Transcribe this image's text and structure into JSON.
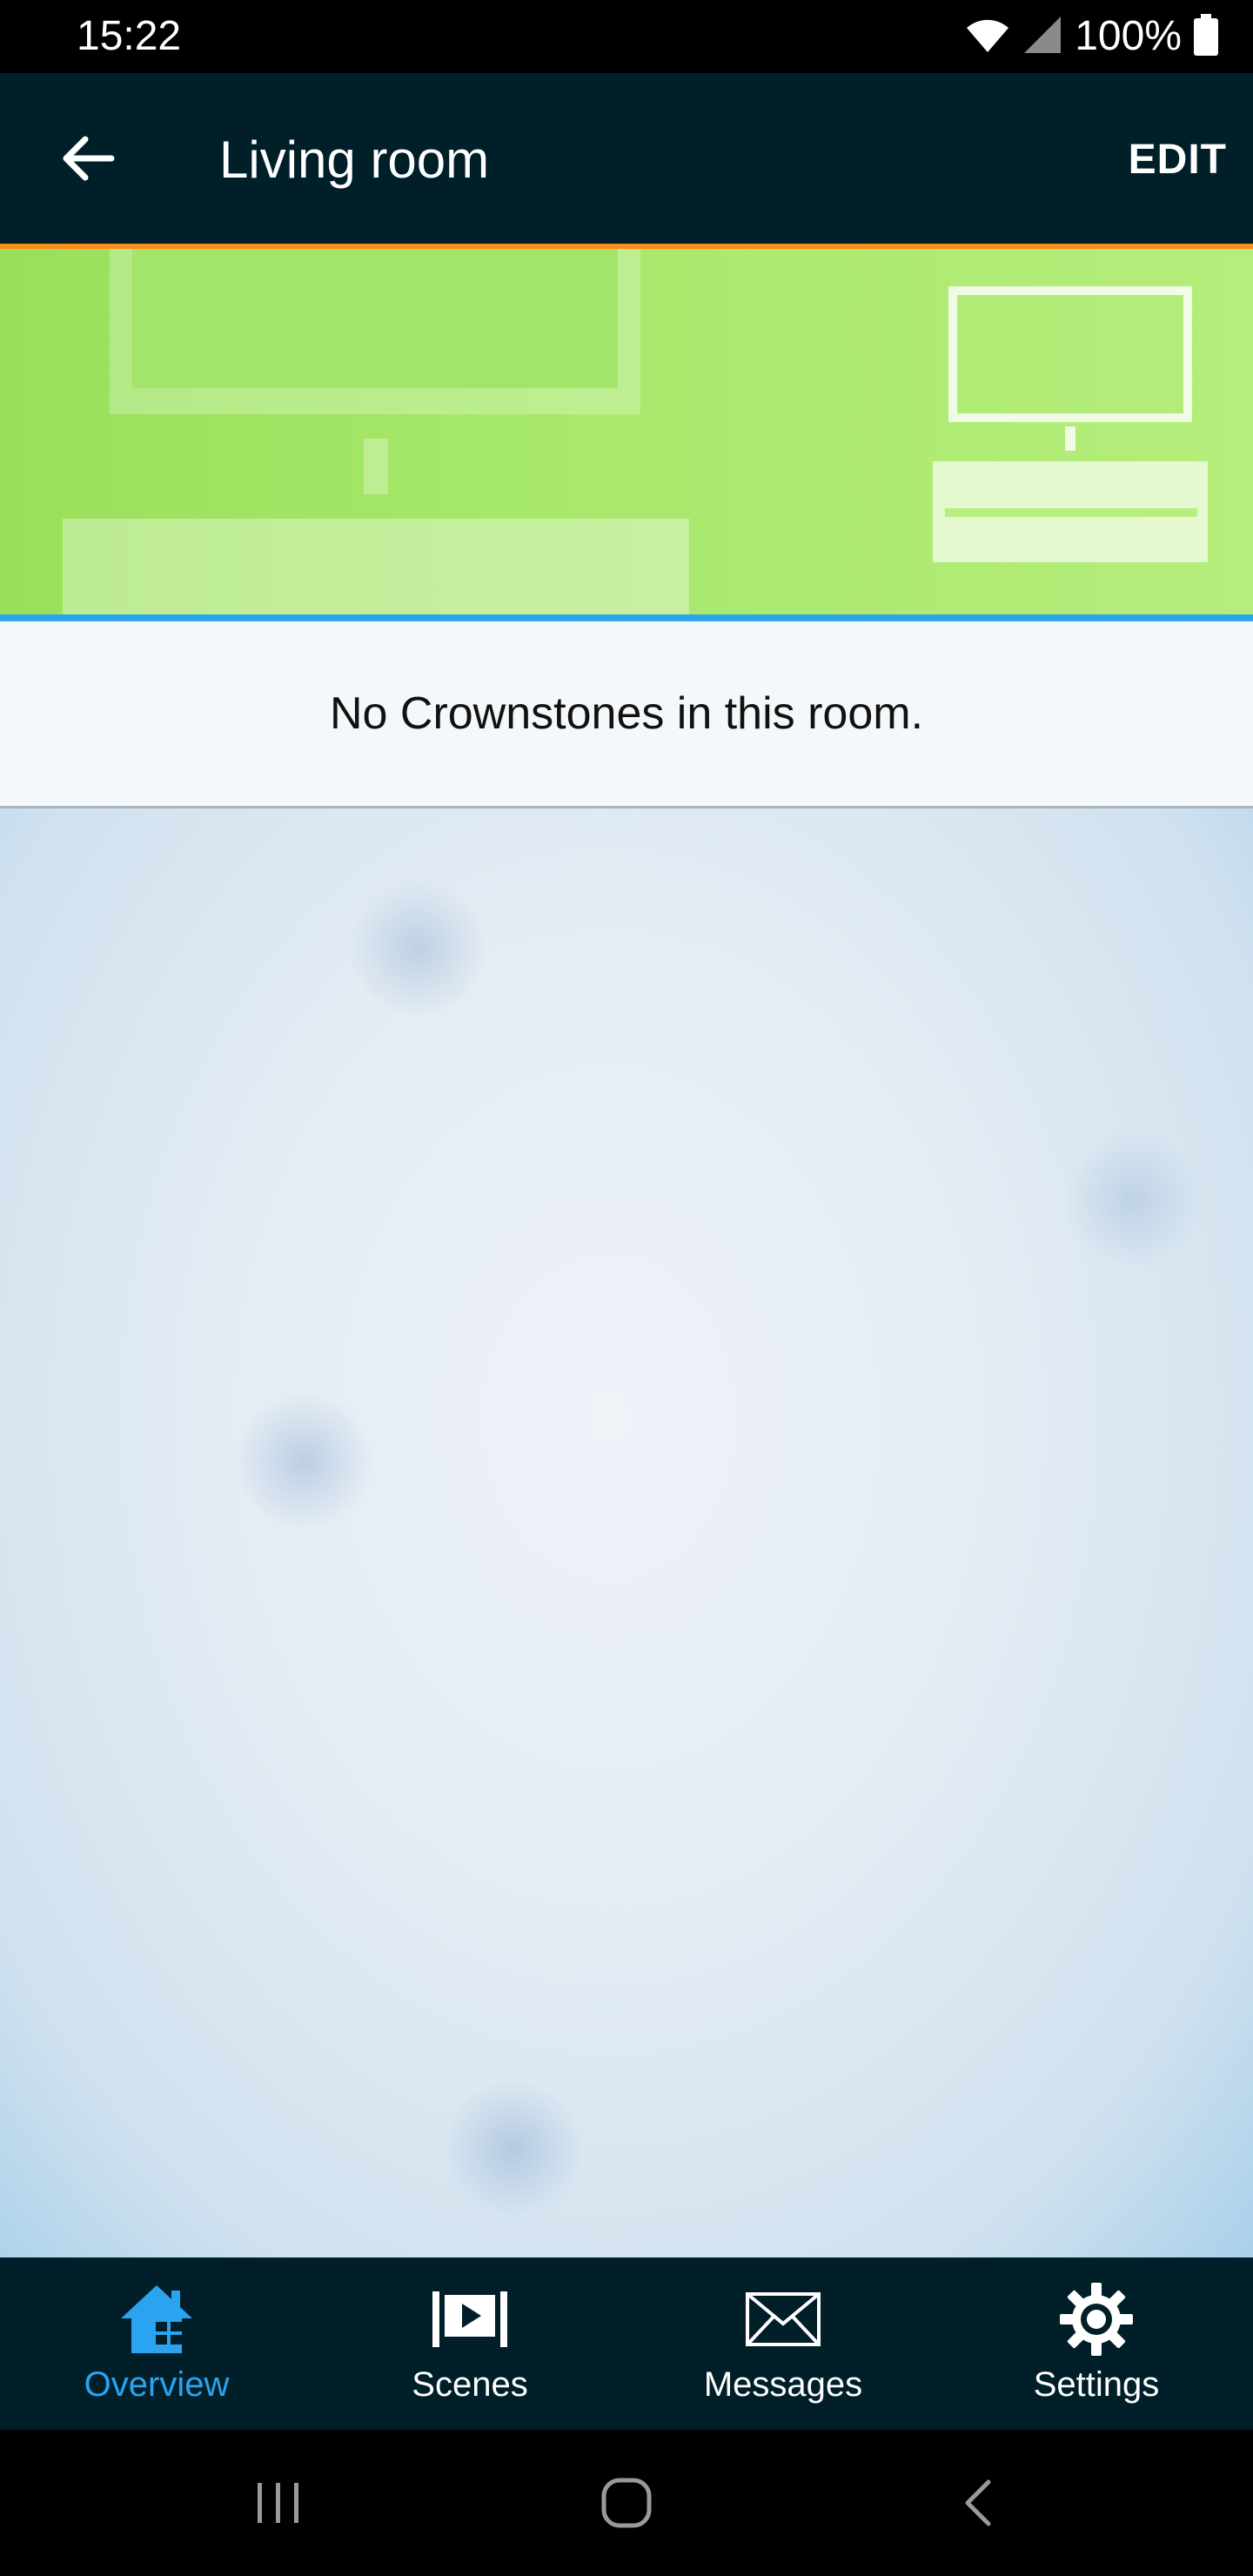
{
  "status_bar": {
    "time": "15:22",
    "battery": "100%"
  },
  "header": {
    "title": "Living room",
    "edit_label": "EDIT",
    "background": "#001f29",
    "accent": "#ff8c1a"
  },
  "room": {
    "empty_message": "No Crownstones in this room."
  },
  "nav": {
    "items": [
      {
        "label": "Overview",
        "icon": "home-icon",
        "active": true
      },
      {
        "label": "Scenes",
        "icon": "scenes-play-icon",
        "active": false
      },
      {
        "label": "Messages",
        "icon": "envelope-icon",
        "active": false
      },
      {
        "label": "Settings",
        "icon": "gear-icon",
        "active": false
      }
    ],
    "active_color": "#2aa3f0"
  }
}
